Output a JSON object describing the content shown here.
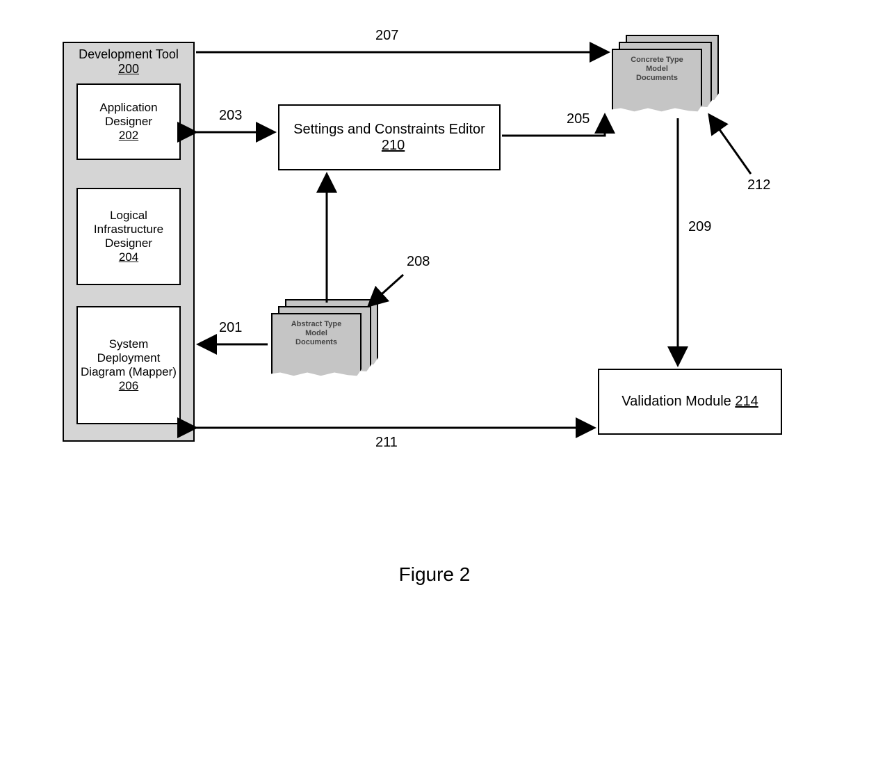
{
  "figureTitle": "Figure 2",
  "devTool": {
    "title": "Development Tool",
    "ref": "200",
    "appDesigner": {
      "title": "Application Designer",
      "ref": "202"
    },
    "logicalInfra": {
      "title": "Logical Infrastructure Designer",
      "ref": "204"
    },
    "deployment": {
      "title": "System Deployment Diagram (Mapper)",
      "ref": "206"
    }
  },
  "settingsEditor": {
    "title": "Settings and Constraints Editor",
    "ref": "210"
  },
  "validation": {
    "title": "Validation Module",
    "ref": "214"
  },
  "abstractDocs": {
    "line1": "Abstract Type",
    "line2": "Model",
    "line3": "Documents"
  },
  "concreteDocs": {
    "line1": "Concrete Type",
    "line2": "Model",
    "line3": "Documents"
  },
  "arrows": {
    "a201": "201",
    "a203": "203",
    "a205": "205",
    "a207": "207",
    "a208": "208",
    "a209": "209",
    "a211": "211",
    "a212": "212"
  }
}
